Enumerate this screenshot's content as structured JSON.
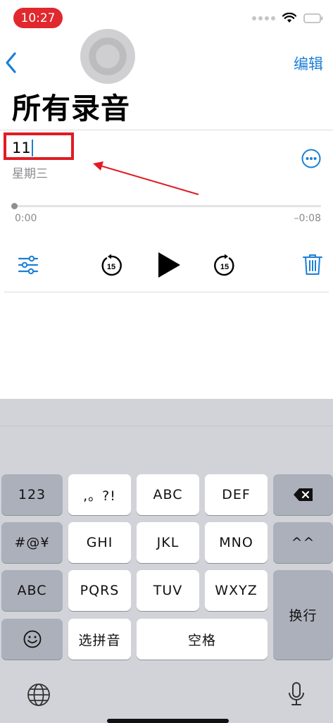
{
  "status": {
    "time": "10:27"
  },
  "nav": {
    "edit_label": "编辑",
    "title": "所有录音"
  },
  "recording": {
    "name_value": "11",
    "date": "星期三",
    "time_start": "0:00",
    "time_end": "–0:08"
  },
  "keyboard": {
    "k123": "123",
    "punct": ",。?!",
    "abc": "ABC",
    "def": "DEF",
    "symbols": "#@¥",
    "ghi": "GHI",
    "jkl": "JKL",
    "mno": "MNO",
    "caret": "^^",
    "abc_mode": "ABC",
    "pqrs": "PQRS",
    "tuv": "TUV",
    "wxyz": "WXYZ",
    "return": "换行",
    "pinyin": "选拼音",
    "space": "空格"
  },
  "colors": {
    "accent": "#1a7fd6",
    "annotation": "#e01b24",
    "time_pill": "#e0282e"
  }
}
